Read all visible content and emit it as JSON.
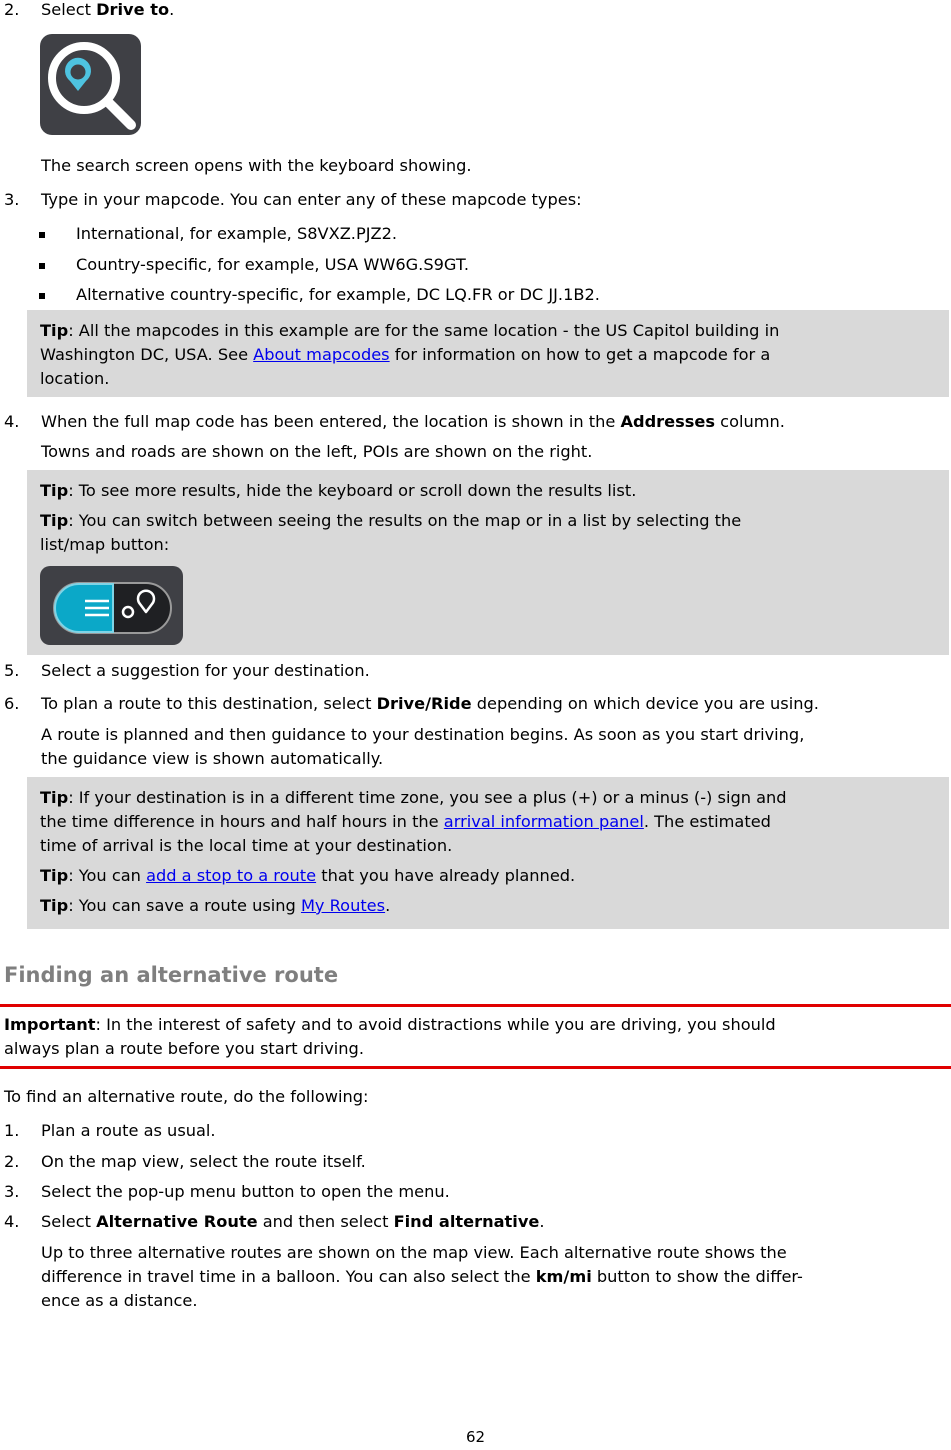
{
  "step2": {
    "num": "2.",
    "text_pre": "Select ",
    "bold": "Drive to",
    "text_post": ".",
    "icon": "drive-to-search-icon",
    "after": "The search screen opens with the keyboard showing."
  },
  "step3": {
    "num": "3.",
    "text": "Type in your mapcode. You can enter any of these mapcode types:",
    "bullets": [
      "International, for example, S8VXZ.PJZ2.",
      "Country-specific, for example, USA WW6G.S9GT.",
      "Alternative country-specific, for example, DC LQ.FR or DC JJ.1B2."
    ]
  },
  "tip1": {
    "label": "Tip",
    "line1": ": All the mapcodes in this example are for the same location - the US Capitol building in",
    "line2_pre": "Washington DC, USA. See ",
    "link": "About mapcodes",
    "line2_post": " for information on how to get a mapcode for a",
    "line3": "location."
  },
  "step4": {
    "num": "4.",
    "text_pre": "When the full map code has been entered, the location is shown in the ",
    "bold": "Addresses",
    "text_post": " column.",
    "after": "Towns and roads are shown on the left, POIs are shown on the right."
  },
  "tip2": {
    "label": "Tip",
    "line1": ": To see more results, hide the keyboard or scroll down the results list.",
    "label2": "Tip",
    "line2": ": You can switch between seeing the results on the map or in a list by selecting the",
    "line3": "list/map button:",
    "icon": "list-map-toggle-icon"
  },
  "step5": {
    "num": "5.",
    "text": "Select a suggestion for your destination."
  },
  "step6": {
    "num": "6.",
    "text_pre": "To plan a route to this destination, select ",
    "bold": "Drive/Ride",
    "text_post": " depending on which device you are using.",
    "after1": "A route is planned and then guidance to your destination begins. As soon as you start driving,",
    "after2": "the guidance view is shown automatically."
  },
  "tip3": {
    "label": "Tip",
    "line1": ": If your destination is in a different time zone, you see a plus (+) or a minus (-) sign and",
    "line2_pre": "the time difference in hours and half hours in the ",
    "link1": "arrival information panel",
    "line2_post": ". The estimated",
    "line3": "time of arrival is the local time at your destination.",
    "label2": "Tip",
    "line4_pre": ": You can ",
    "link2": "add a stop to a route",
    "line4_post": " that you have already planned.",
    "label3": "Tip",
    "line5_pre": ": You can save a route using ",
    "link3": "My Routes",
    "line5_post": "."
  },
  "section": {
    "heading": "Finding an alternative route",
    "important_label": "Important",
    "important_line1": ": In the interest of safety and to avoid distractions while you are driving, you should",
    "important_line2": "always plan a route before you start driving.",
    "intro": "To find an alternative route, do the following:",
    "steps": [
      {
        "num": "1.",
        "text": "Plan a route as usual."
      },
      {
        "num": "2.",
        "text": "On the map view, select the route itself."
      },
      {
        "num": "3.",
        "text": "Select the pop-up menu button to open the menu."
      }
    ],
    "step4": {
      "num": "4.",
      "text_pre": "Select ",
      "bold1": "Alternative Route",
      "text_mid": " and then select ",
      "bold2": "Find alternative",
      "text_post": "."
    },
    "after1": "Up to three alternative routes are shown on the map view. Each alternative route shows the",
    "after2_pre": "difference in travel time in a balloon. You can also select the ",
    "after2_bold": "km/mi",
    "after2_post": " button to show the differ-",
    "after3": "ence as a distance."
  },
  "page_number": "62",
  "colors": {
    "tip_background": "#d9d9d9",
    "link": "#0000ee",
    "heading": "#7f7f7f",
    "important_rule": "#e00000",
    "icon_dark": "#3f4045",
    "icon_cyan": "#4ec3e0"
  }
}
